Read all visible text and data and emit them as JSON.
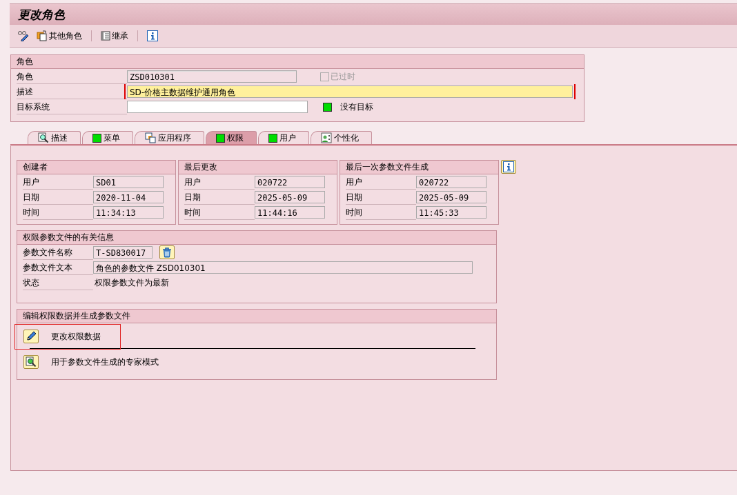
{
  "window": {
    "title": "更改角色"
  },
  "toolbar": [
    {
      "kind": "display-change"
    },
    {
      "kind": "other-role",
      "label": "其他角色"
    },
    {
      "kind": "inherit",
      "label": "继承"
    },
    {
      "kind": "info"
    }
  ],
  "role_group": {
    "title": "角色",
    "rows": [
      {
        "label": "角色",
        "field": {
          "kind": "display",
          "value": "ZSD010301"
        },
        "checkbox": {
          "label": "已过时",
          "checked": false,
          "disabled": true
        }
      },
      {
        "label": "描述",
        "field": {
          "kind": "required",
          "value": "SD-价格主数据维护通用角色"
        }
      },
      {
        "label": "目标系统",
        "field": {
          "kind": "input"
        },
        "status": {
          "color": "#00dd00",
          "label": "没有目标"
        }
      }
    ]
  },
  "tabs": [
    {
      "label": "描述",
      "kind": "describe",
      "selected": false
    },
    {
      "label": "菜单",
      "kind": "status",
      "color": "#00dd00",
      "selected": false
    },
    {
      "label": "应用程序",
      "kind": "apps",
      "selected": false
    },
    {
      "label": "权限",
      "kind": "status",
      "color": "#00dd00",
      "selected": true
    },
    {
      "label": "用户",
      "kind": "status",
      "color": "#00dd00",
      "selected": false
    },
    {
      "label": "个性化",
      "kind": "personal",
      "selected": false
    }
  ],
  "info_groups": [
    {
      "title": "创建者",
      "rows": [
        {
          "label": "用户",
          "value": "SD01"
        },
        {
          "label": "日期",
          "value": "2020-11-04"
        },
        {
          "label": "时间",
          "value": "11:34:13"
        }
      ]
    },
    {
      "title": "最后更改",
      "rows": [
        {
          "label": "用户",
          "value": "020722"
        },
        {
          "label": "日期",
          "value": "2025-05-09"
        },
        {
          "label": "时间",
          "value": "11:44:16"
        }
      ]
    },
    {
      "title": "最后一次参数文件生成",
      "rows": [
        {
          "label": "用户",
          "value": "020722"
        },
        {
          "label": "日期",
          "value": "2025-05-09"
        },
        {
          "label": "时间",
          "value": "11:45:33"
        }
      ]
    }
  ],
  "profile_group": {
    "title": "权限参数文件的有关信息",
    "rows": [
      {
        "label": "参数文件名称",
        "value": "T-SD830017",
        "kind": "short"
      },
      {
        "label": "参数文件文本",
        "value": "角色的参数文件 ZSD010301",
        "kind": "long"
      },
      {
        "label": "状态",
        "value": "权限参数文件为最新",
        "kind": "text"
      }
    ]
  },
  "edit_group": {
    "title": "编辑权限数据并生成参数文件",
    "actions": [
      {
        "kind": "pencil",
        "label": "更改权限数据",
        "highlighted": true
      },
      {
        "kind": "expert",
        "label": "用于参数文件生成的专家模式",
        "highlighted": false
      }
    ]
  }
}
